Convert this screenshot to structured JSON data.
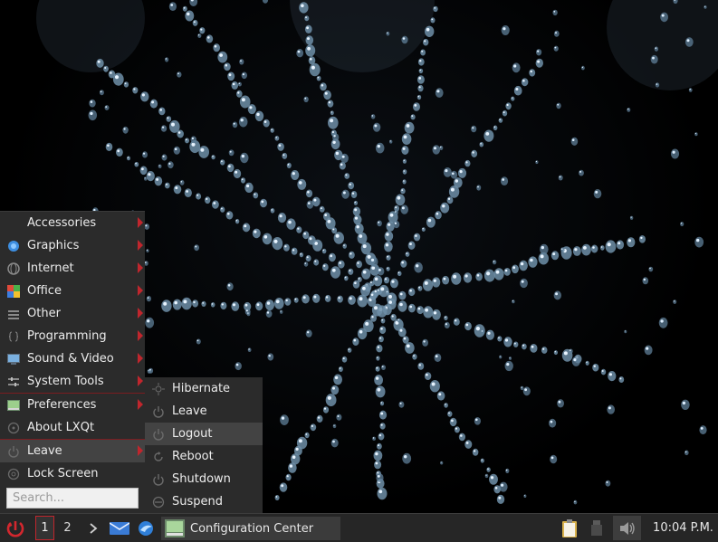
{
  "menu": {
    "items": [
      {
        "label": "Accessories",
        "icon": "accessories-icon",
        "submenu": true
      },
      {
        "label": "Graphics",
        "icon": "graphics-icon",
        "submenu": true
      },
      {
        "label": "Internet",
        "icon": "internet-icon",
        "submenu": true
      },
      {
        "label": "Office",
        "icon": "office-icon",
        "submenu": true
      },
      {
        "label": "Other",
        "icon": "other-icon",
        "submenu": true
      },
      {
        "label": "Programming",
        "icon": "programming-icon",
        "submenu": true
      },
      {
        "label": "Sound & Video",
        "icon": "sound-video-icon",
        "submenu": true
      },
      {
        "label": "System Tools",
        "icon": "system-tools-icon",
        "submenu": true
      },
      {
        "label": "Preferences",
        "icon": "preferences-icon",
        "submenu": true
      },
      {
        "label": "About LXQt",
        "icon": "about-icon",
        "submenu": false
      },
      {
        "label": "Leave",
        "icon": "leave-icon",
        "submenu": true,
        "active": true
      },
      {
        "label": "Lock Screen",
        "icon": "lock-screen-icon",
        "submenu": false
      }
    ],
    "search_placeholder": "Search..."
  },
  "leave_submenu": {
    "items": [
      {
        "label": "Hibernate",
        "icon": "hibernate-icon"
      },
      {
        "label": "Leave",
        "icon": "power-icon"
      },
      {
        "label": "Logout",
        "icon": "logout-icon",
        "active": true
      },
      {
        "label": "Reboot",
        "icon": "reboot-icon"
      },
      {
        "label": "Shutdown",
        "icon": "shutdown-icon"
      },
      {
        "label": "Suspend",
        "icon": "suspend-icon"
      }
    ]
  },
  "taskbar": {
    "desktops": [
      "1",
      "2"
    ],
    "task_label": "Configuration Center",
    "clock": "10:04 P.M."
  },
  "colors": {
    "accent": "#c0262d",
    "menu_bg": "#2b2b2b",
    "taskbar_bg": "#262626"
  }
}
